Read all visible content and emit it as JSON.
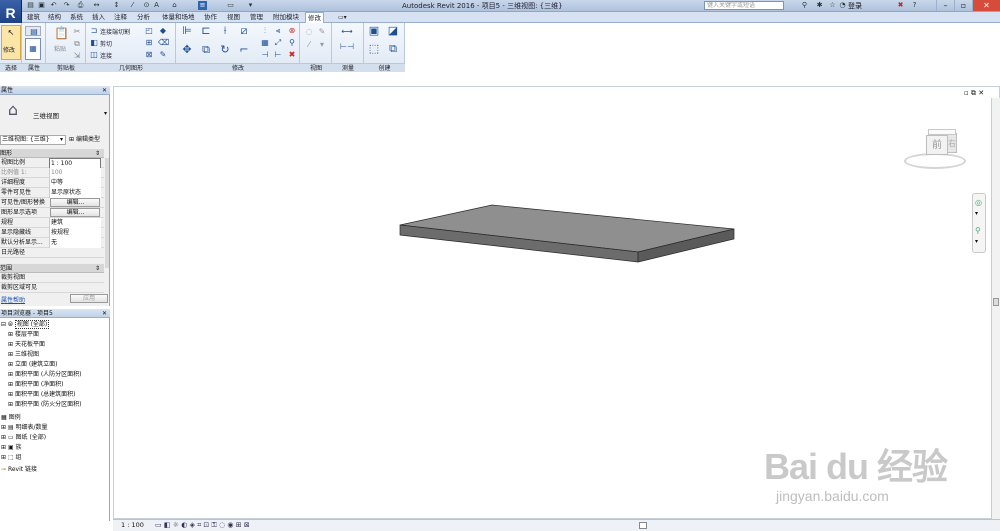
{
  "titlebar": {
    "app_logo": "R",
    "title": "Autodesk Revit 2016 -",
    "doc": "项目5 - 三维视图: {三维}",
    "search_placeholder": "键入关键字或短语",
    "login": "登录",
    "minimize": "–",
    "restore": "▫",
    "close": "✕"
  },
  "tabs": [
    "建筑",
    "结构",
    "系统",
    "插入",
    "注释",
    "分析",
    "体量和场地",
    "协作",
    "视图",
    "管理",
    "附加模块",
    "修改"
  ],
  "active_tab": "修改",
  "ribbon": {
    "modify_label": "修改",
    "select_label": "选择",
    "properties_label": "属性",
    "clipboard_label": "剪贴板",
    "clipboard_paste": "粘贴",
    "geometry_label": "几何图形",
    "geom_items": [
      "连接端切割",
      "剪切",
      "连接"
    ],
    "modify_panel_label": "修改",
    "view_label": "视图",
    "measure_label": "测量",
    "create_label": "创建"
  },
  "properties": {
    "header": "属性",
    "type_name": "三维视图",
    "instance_selector": "三维视图: {三维}",
    "edit_type": "编辑类型",
    "section_graphics": "图形",
    "rows": [
      {
        "k": "视图比例",
        "v": "1 : 100"
      },
      {
        "k": "比例值 1:",
        "v": "100"
      },
      {
        "k": "详细程度",
        "v": "中等"
      },
      {
        "k": "零件可见性",
        "v": "显示原状态"
      },
      {
        "k": "可见性/图形替换",
        "v": "编辑..."
      },
      {
        "k": "图形显示选项",
        "v": "编辑..."
      },
      {
        "k": "规程",
        "v": "建筑"
      },
      {
        "k": "显示隐藏线",
        "v": "按规程"
      },
      {
        "k": "默认分析显示...",
        "v": "无"
      },
      {
        "k": "日光路径",
        "v": ""
      }
    ],
    "section_extents": "范围",
    "extents_rows": [
      {
        "k": "裁剪视图",
        "v": ""
      },
      {
        "k": "裁剪区域可见",
        "v": ""
      }
    ],
    "help_link": "属性帮助",
    "apply": "应用"
  },
  "browser": {
    "header": "项目浏览器 - 项目5",
    "root": "视图 (全部)",
    "views": [
      "楼层平面",
      "天花板平面",
      "三维视图",
      "立面 (建筑立面)",
      "面积平面 (人防分区面积)",
      "面积平面 (净面积)",
      "面积平面 (总建筑面积)",
      "面积平面 (防火分区面积)"
    ],
    "others": [
      "图例",
      "明细表/数量",
      "图纸 (全部)",
      "族",
      "组",
      "Revit 链接"
    ]
  },
  "viewcube": {
    "front": "前",
    "right": "右"
  },
  "statusbar": {
    "scale": "1 : 100"
  },
  "watermark": {
    "logo": "Bai du 经验",
    "url": "jingyan.baidu.com"
  }
}
